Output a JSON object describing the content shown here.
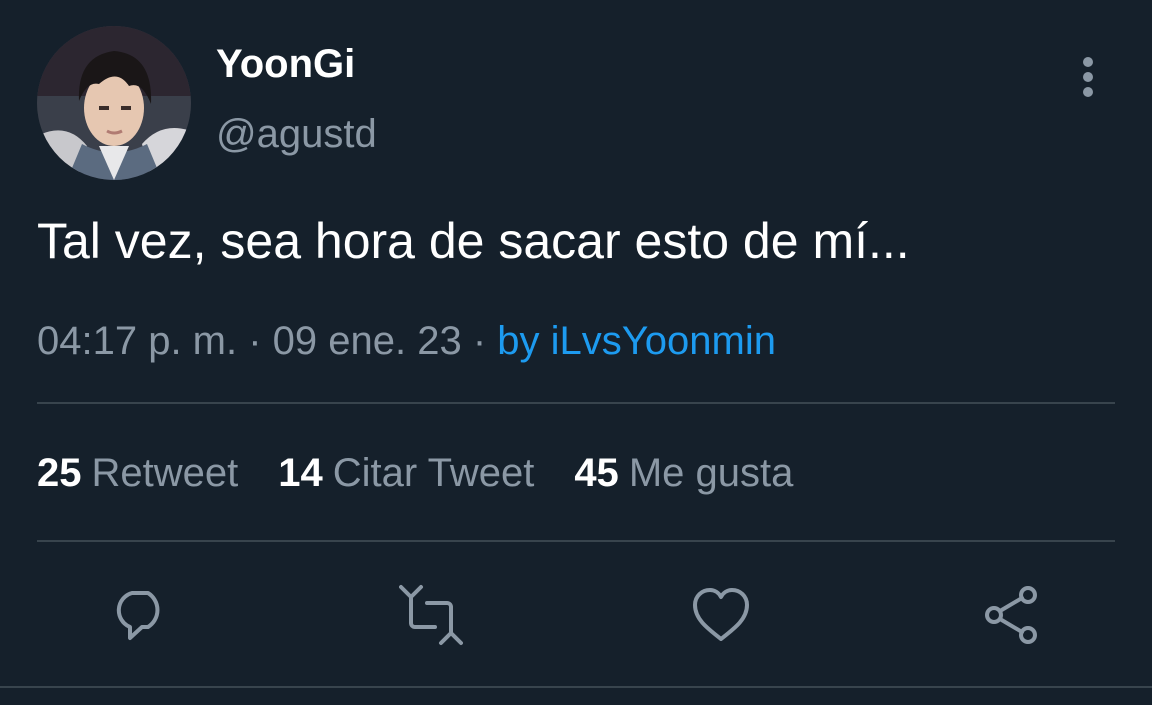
{
  "tweet": {
    "display_name": "YoonGi",
    "handle": "@agustd",
    "text": "Tal vez, sea hora de sacar esto de mí...",
    "time": "04:17 p. m.",
    "separator": " · ",
    "date": "09 ene. 23",
    "via": "by iLvsYoonmin"
  },
  "stats": [
    {
      "count": "25",
      "label": "Retweet"
    },
    {
      "count": "14",
      "label": "Citar Tweet"
    },
    {
      "count": "45",
      "label": "Me gusta"
    }
  ],
  "actions": [
    {
      "icon": "reply-icon"
    },
    {
      "icon": "retweet-icon"
    },
    {
      "icon": "heart-icon"
    },
    {
      "icon": "share-icon"
    }
  ],
  "colors": {
    "background": "#15202b",
    "text_primary": "#ffffff",
    "text_secondary": "#8b98a5",
    "link": "#1d9bf0",
    "divider": "#38444d"
  }
}
